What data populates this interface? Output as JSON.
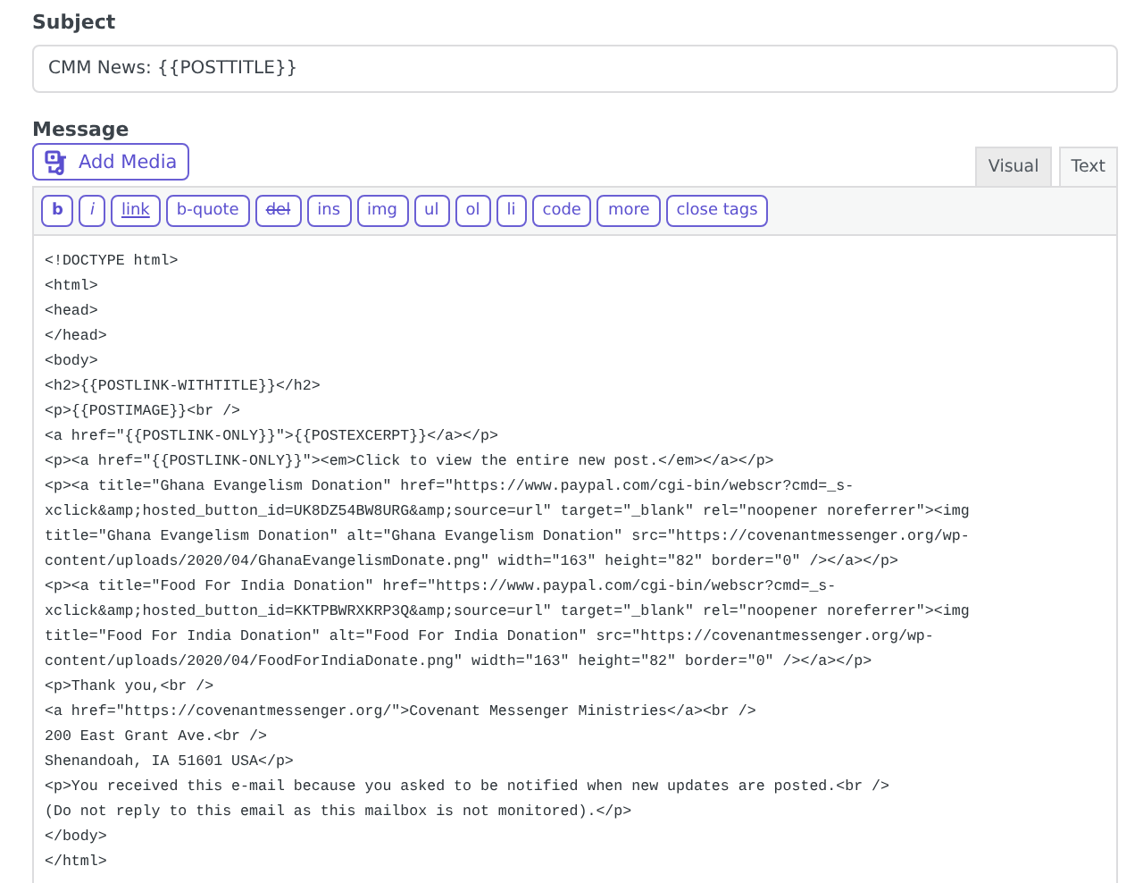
{
  "subject": {
    "label": "Subject",
    "value": "CMM News: {{POSTTITLE}}"
  },
  "message": {
    "label": "Message",
    "add_media": "Add Media",
    "tabs": [
      {
        "label": "Visual",
        "selected": false
      },
      {
        "label": "Text",
        "selected": true
      }
    ],
    "quicktags": [
      {
        "label": "b",
        "kind": "bold"
      },
      {
        "label": "i",
        "kind": "italic"
      },
      {
        "label": "link",
        "kind": "link"
      },
      {
        "label": "b-quote",
        "kind": "plain"
      },
      {
        "label": "del",
        "kind": "strike"
      },
      {
        "label": "ins",
        "kind": "plain"
      },
      {
        "label": "img",
        "kind": "plain"
      },
      {
        "label": "ul",
        "kind": "plain"
      },
      {
        "label": "ol",
        "kind": "plain"
      },
      {
        "label": "li",
        "kind": "plain"
      },
      {
        "label": "code",
        "kind": "plain"
      },
      {
        "label": "more",
        "kind": "plain"
      },
      {
        "label": "close tags",
        "kind": "plain"
      }
    ],
    "code_lines": [
      "<!DOCTYPE html>",
      "<html>",
      "<head>",
      "</head>",
      "<body>",
      "<h2>{{POSTLINK-WITHTITLE}}</h2>",
      "<p>{{POSTIMAGE}}<br />",
      "<a href=\"{{POSTLINK-ONLY}}\">{{POSTEXCERPT}}</a></p>",
      "<p><a href=\"{{POSTLINK-ONLY}}\"><em>Click to view the entire new post.</em></a></p>",
      "<p><a title=\"Ghana Evangelism Donation\" href=\"https://www.paypal.com/cgi-bin/webscr?cmd=_s-",
      "xclick&amp;hosted_button_id=UK8DZ54BW8URG&amp;source=url\" target=\"_blank\" rel=\"noopener noreferrer\"><img",
      "title=\"Ghana Evangelism Donation\" alt=\"Ghana Evangelism Donation\" src=\"https://covenantmessenger.org/wp-",
      "content/uploads/2020/04/GhanaEvangelismDonate.png\" width=\"163\" height=\"82\" border=\"0\" /></a></p>",
      "<p><a title=\"Food For India Donation\" href=\"https://www.paypal.com/cgi-bin/webscr?cmd=_s-",
      "xclick&amp;hosted_button_id=KKTPBWRXKRP3Q&amp;source=url\" target=\"_blank\" rel=\"noopener noreferrer\"><img",
      "title=\"Food For India Donation\" alt=\"Food For India Donation\" src=\"https://covenantmessenger.org/wp-",
      "content/uploads/2020/04/FoodForIndiaDonate.png\" width=\"163\" height=\"82\" border=\"0\" /></a></p>",
      "<p>Thank you,<br />",
      "<a href=\"https://covenantmessenger.org/\">Covenant Messenger Ministries</a><br />",
      "200 East Grant Ave.<br />",
      "Shenandoah, IA 51601 USA</p>",
      "<p>You received this e-mail because you asked to be notified when new updates are posted.<br />",
      "(Do not reply to this email as this mailbox is not monitored).</p>",
      "</body>",
      "</html>"
    ]
  }
}
